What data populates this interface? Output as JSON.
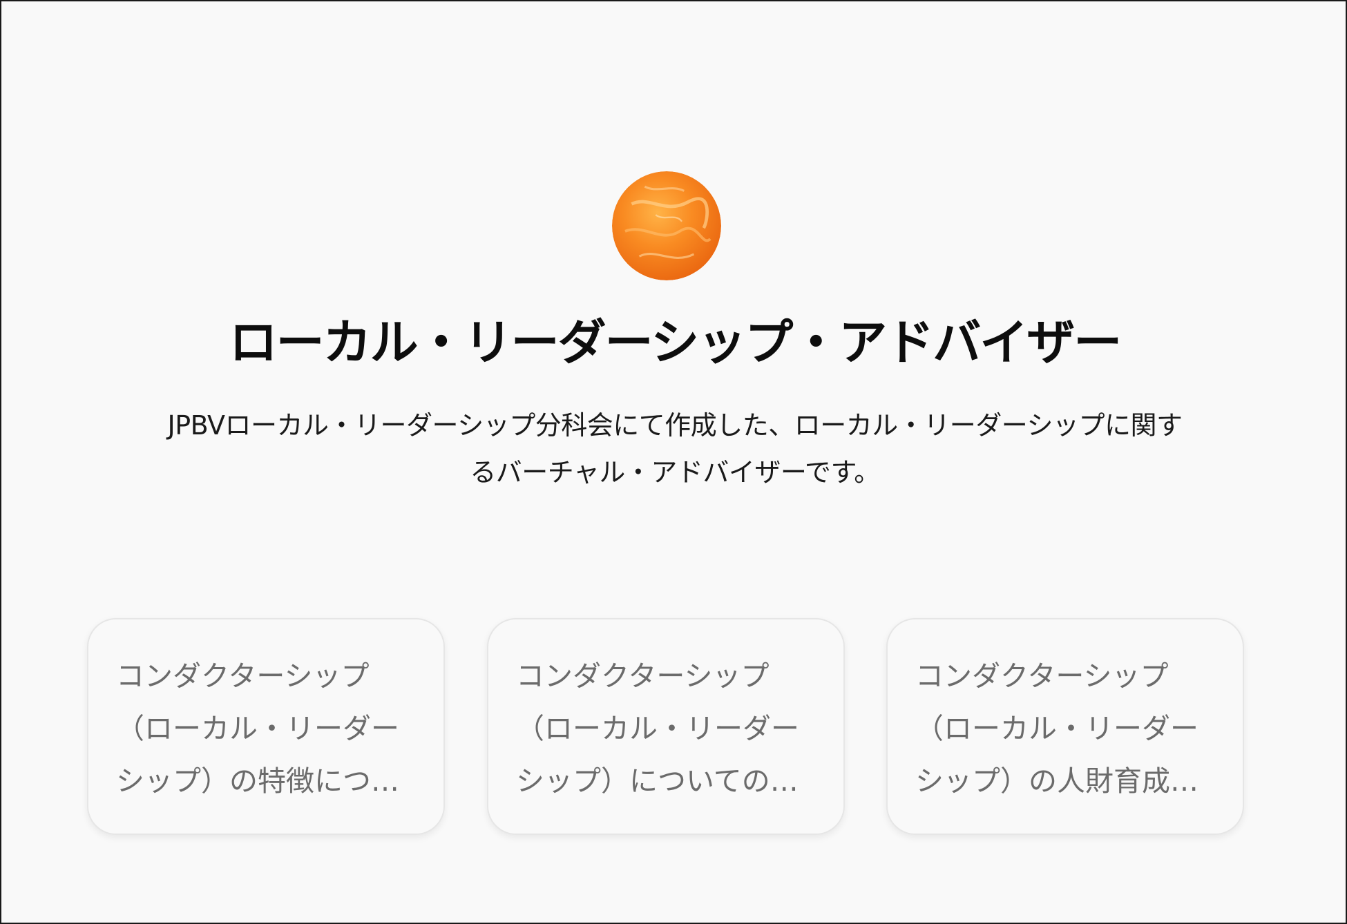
{
  "header": {
    "avatar_icon": "orange-marble-sphere-icon",
    "title": "ローカル・リーダーシップ・アドバイザー",
    "description": "JPBVローカル・リーダーシップ分科会にて作成した、ローカル・リーダーシップに関するバーチャル・アドバイザーです。"
  },
  "colors": {
    "background": "#f9f9f9",
    "accent_orange": "#f5841f",
    "title_text": "#0d0d0d",
    "card_text": "#6b6b6b"
  },
  "suggestions": [
    {
      "text": "コンダクターシップ（ローカル・リーダーシップ）の特徴について知りた..."
    },
    {
      "text": "コンダクターシップ（ローカル・リーダーシップ）についての質問をした..."
    },
    {
      "text": "コンダクターシップ（ローカル・リーダーシップ）の人財育成プログラム..."
    }
  ]
}
